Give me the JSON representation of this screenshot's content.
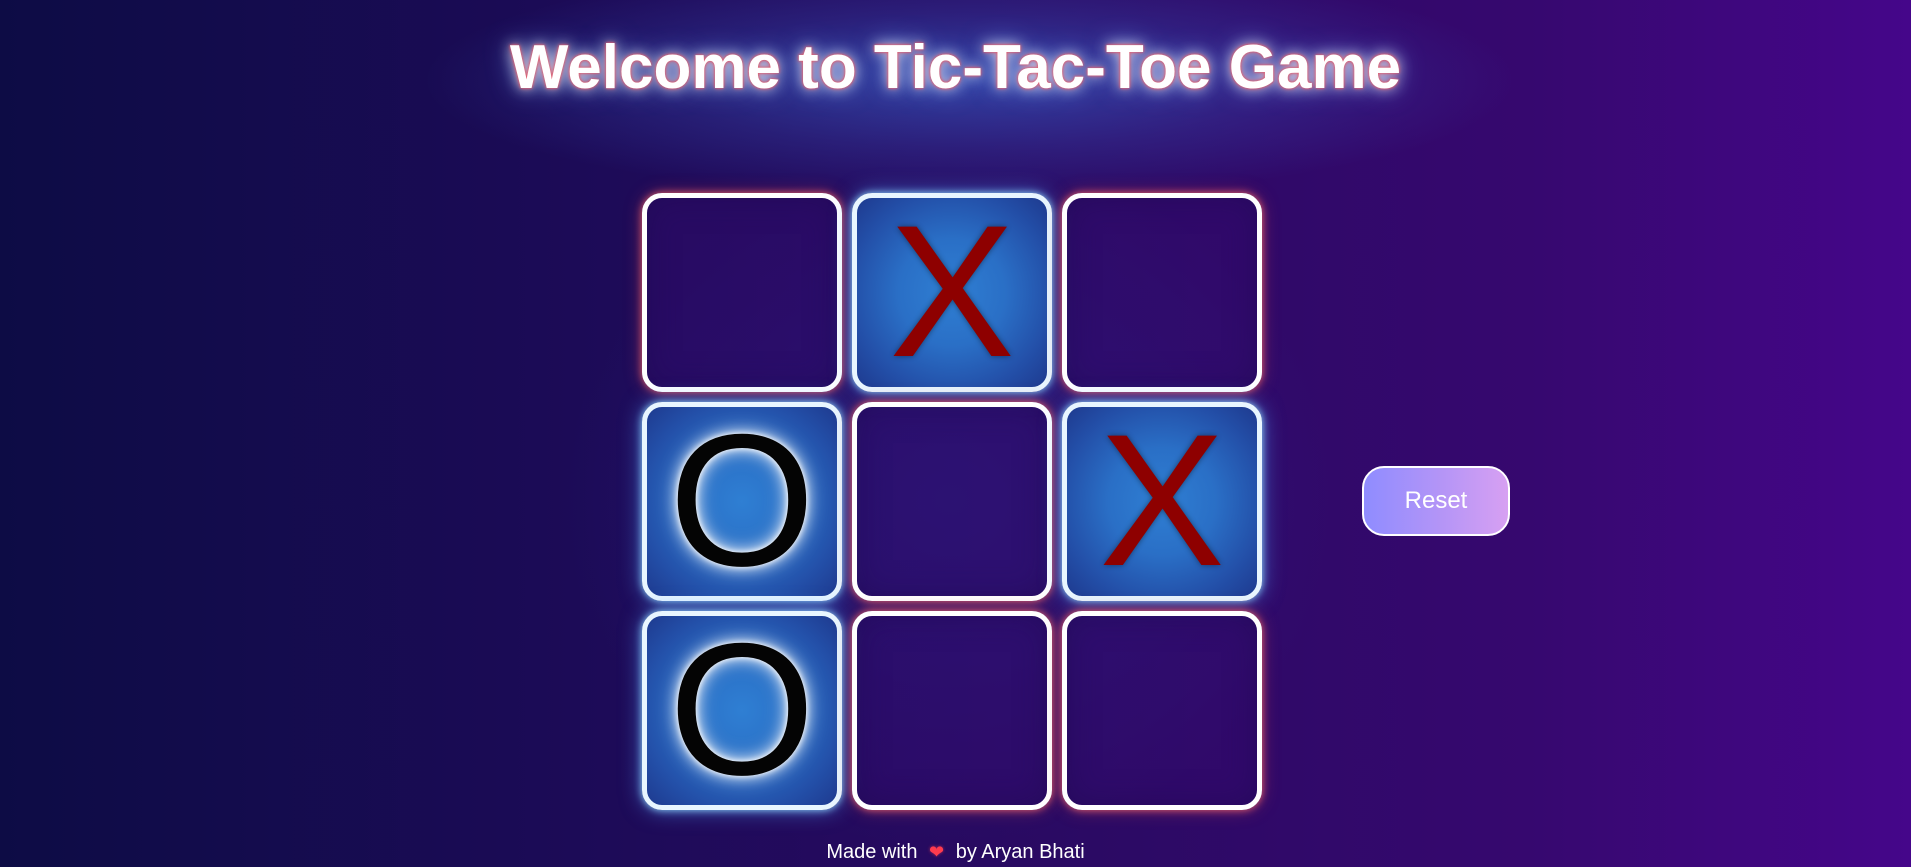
{
  "title": "Welcome to Tic-Tac-Toe Game",
  "board": {
    "cells": [
      {
        "mark": ""
      },
      {
        "mark": "X"
      },
      {
        "mark": ""
      },
      {
        "mark": "O"
      },
      {
        "mark": ""
      },
      {
        "mark": "X"
      },
      {
        "mark": "O"
      },
      {
        "mark": ""
      },
      {
        "mark": ""
      }
    ]
  },
  "controls": {
    "reset_label": "Reset"
  },
  "footer": {
    "prefix": "Made with",
    "heart_icon": "heart-icon",
    "suffix": "by Aryan Bhati"
  },
  "colors": {
    "x_mark": "#8e0000",
    "o_mark": "#040404",
    "cell_border": "#ffffff",
    "filled_cell": "#2f7fd3",
    "reset_button": "#a590fa"
  }
}
